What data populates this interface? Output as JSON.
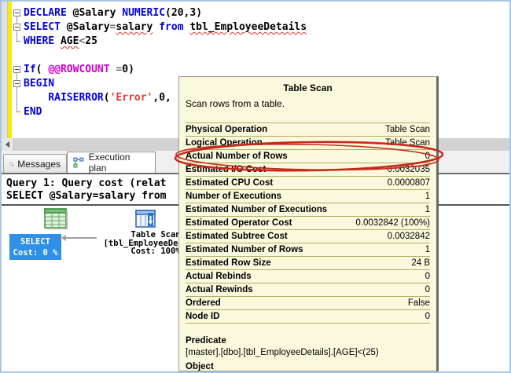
{
  "colors": {
    "frame_border": "#a9c6e3",
    "keyword_blue": "#0202dd",
    "system_function_magenta": "#cc00cc",
    "string_red": "#e03c3c",
    "operator_gray": "#707070",
    "change_bar_yellow": "#f6ee02",
    "selected_node_bg": "#2e90e6",
    "tooltip_bg": "#fbf9dd",
    "tooltip_row_line": "#aeae62",
    "highlight_ellipse_red": "#c5291c"
  },
  "icons": {
    "messages-icon": "notepad-with-pencil",
    "execution-plan-icon": "linked-plan-squares",
    "fold-minus-icon": "collapse-minus-box",
    "scroll-left-icon": "left-triangle",
    "select-node-icon": "green-result-grid",
    "table-scan-icon": "blue-table"
  },
  "editor": {
    "lines": [
      {
        "fold": "minus",
        "segments": [
          {
            "t": "DECLARE ",
            "c": "kw"
          },
          {
            "t": "@Salary ",
            "c": "plain"
          },
          {
            "t": "NUMERIC",
            "c": "kw"
          },
          {
            "t": "(",
            "c": "plain"
          },
          {
            "t": "20",
            "c": "plain"
          },
          {
            "t": ",",
            "c": "plain"
          },
          {
            "t": "3",
            "c": "plain"
          },
          {
            "t": ")",
            "c": "plain"
          }
        ]
      },
      {
        "fold": "minus",
        "segments": [
          {
            "t": "SELECT ",
            "c": "kw"
          },
          {
            "t": "@Salary",
            "c": "plain"
          },
          {
            "t": "=",
            "c": "op"
          },
          {
            "t": "salary",
            "c": "err"
          },
          {
            "t": " ",
            "c": "plain"
          },
          {
            "t": "from",
            "c": "kw"
          },
          {
            "t": " ",
            "c": "plain"
          },
          {
            "t": "tbl_EmployeeDetails",
            "c": "err"
          }
        ]
      },
      {
        "fold": "tick",
        "segments": [
          {
            "t": "WHERE ",
            "c": "kw"
          },
          {
            "t": "AGE",
            "c": "err"
          },
          {
            "t": "<",
            "c": "op"
          },
          {
            "t": "25",
            "c": "plain"
          }
        ]
      },
      {
        "fold": "none",
        "segments": []
      },
      {
        "fold": "minus",
        "segments": [
          {
            "t": "If",
            "c": "kw"
          },
          {
            "t": "( ",
            "c": "plain"
          },
          {
            "t": "@@ROWCOUNT",
            "c": "sys"
          },
          {
            "t": " ",
            "c": "plain"
          },
          {
            "t": "=",
            "c": "op"
          },
          {
            "t": "0",
            "c": "plain"
          },
          {
            "t": ")",
            "c": "plain"
          }
        ]
      },
      {
        "fold": "minus",
        "segments": [
          {
            "t": "BEGIN",
            "c": "kw"
          }
        ]
      },
      {
        "fold": "none",
        "segments": [
          {
            "t": "    ",
            "c": "plain"
          },
          {
            "t": "RAISERROR",
            "c": "kw"
          },
          {
            "t": "(",
            "c": "plain"
          },
          {
            "t": "'Error'",
            "c": "str"
          },
          {
            "t": ",",
            "c": "plain"
          },
          {
            "t": "0",
            "c": "plain"
          },
          {
            "t": ",",
            "c": "plain"
          }
        ]
      },
      {
        "fold": "tick",
        "segments": [
          {
            "t": "END",
            "c": "kw"
          }
        ]
      }
    ]
  },
  "tabs": [
    {
      "label": "Messages",
      "active": false
    },
    {
      "label": "Execution plan",
      "active": true
    }
  ],
  "plan": {
    "query_header": {
      "line1": "Query 1: Query cost (relat",
      "line2": "SELECT @Salary=salary from"
    },
    "select_node": {
      "title": "SELECT",
      "cost": "Cost: 0 %"
    },
    "table_scan_node": {
      "title": "Table Scan",
      "object": "[tbl_EmployeeDetails]",
      "cost": "Cost: 100%"
    }
  },
  "tooltip": {
    "title": "Table Scan",
    "description": "Scan rows from a table.",
    "rows": [
      {
        "label": "Physical Operation",
        "value": "Table Scan",
        "highlighted": false
      },
      {
        "label": "Logical Operation",
        "value": "Table Scan",
        "highlighted": false
      },
      {
        "label": "Actual Number of Rows",
        "value": "0",
        "highlighted": true
      },
      {
        "label": "Estimated I/O Cost",
        "value": "0.0032035",
        "highlighted": false
      },
      {
        "label": "Estimated CPU Cost",
        "value": "0.0000807",
        "highlighted": false
      },
      {
        "label": "Number of Executions",
        "value": "1",
        "highlighted": false
      },
      {
        "label": "Estimated Number of Executions",
        "value": "1",
        "highlighted": false
      },
      {
        "label": "Estimated Operator Cost",
        "value": "0.0032842 (100%)",
        "highlighted": false
      },
      {
        "label": "Estimated Subtree Cost",
        "value": "0.0032842",
        "highlighted": false
      },
      {
        "label": "Estimated Number of Rows",
        "value": "1",
        "highlighted": false
      },
      {
        "label": "Estimated Row Size",
        "value": "24 B",
        "highlighted": false
      },
      {
        "label": "Actual Rebinds",
        "value": "0",
        "highlighted": false
      },
      {
        "label": "Actual Rewinds",
        "value": "0",
        "highlighted": false
      },
      {
        "label": "Ordered",
        "value": "False",
        "highlighted": false
      },
      {
        "label": "Node ID",
        "value": "0",
        "highlighted": false
      }
    ],
    "predicate_header": "Predicate",
    "predicate_value": "[master].[dbo].[tbl_EmployeeDetails].[AGE]<(25)",
    "clipped_bottom_label": "Object"
  }
}
